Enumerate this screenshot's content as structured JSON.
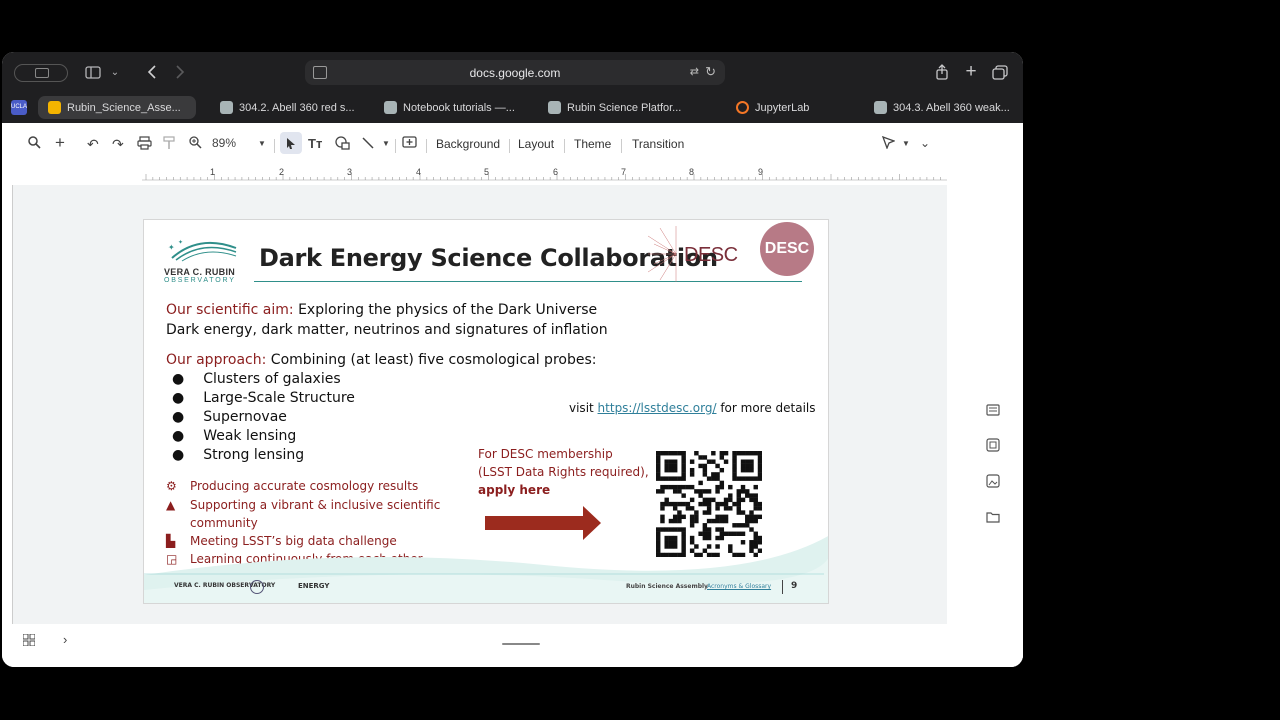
{
  "browser": {
    "url": "docs.google.com",
    "tabs": [
      {
        "label": "Rubin_Science_Asse...",
        "active": true,
        "favicon": "slides-icon",
        "color": "#f4b400"
      },
      {
        "label": "304.2. Abell 360 red s...",
        "active": false,
        "favicon": "notebook-icon",
        "color": "#9aa"
      },
      {
        "label": "Notebook tutorials —...",
        "active": false,
        "favicon": "notebook-icon",
        "color": "#9aa"
      },
      {
        "label": "Rubin Science Platfor...",
        "active": false,
        "favicon": "notebook-icon",
        "color": "#9aa"
      },
      {
        "label": "JupyterLab",
        "active": false,
        "favicon": "jupyter-icon",
        "color": "#f37626"
      },
      {
        "label": "304.3. Abell 360 weak...",
        "active": false,
        "favicon": "notebook-icon",
        "color": "#9aa"
      }
    ]
  },
  "toolbar": {
    "zoom": "89%",
    "menus": [
      "Background",
      "Layout",
      "Theme",
      "Transition"
    ]
  },
  "ruler": {
    "ticks": [
      "1",
      "2",
      "3",
      "4",
      "5",
      "6",
      "7",
      "8",
      "9"
    ]
  },
  "slide": {
    "rubin_logo": {
      "line1": "VERA C. RUBIN",
      "line2": "OBSERVATORY"
    },
    "title": "Dark Energy Science Collaboration",
    "desc_wordmark": "DESC",
    "desc_badge": "DESC",
    "aim_label": "Our scientific aim:",
    "aim_text": " Exploring the physics of the Dark Universe",
    "aim_line2": "Dark energy, dark matter, neutrinos and signatures of inflation",
    "approach_label": "Our approach:",
    "approach_text": " Combining (at least) five cosmological probes:",
    "probes": [
      "Clusters of galaxies",
      "Large-Scale Structure",
      "Supernovae",
      "Weak lensing",
      "Strong lensing"
    ],
    "visit_prefix": "visit ",
    "visit_link": "https://lsstdesc.org/",
    "visit_suffix": " for more details",
    "membership_line1": "For DESC membership",
    "membership_line2": "(LSST Data Rights required),",
    "membership_line3": "apply here",
    "features": [
      {
        "icon": "gears-icon",
        "text": "Producing accurate cosmology results"
      },
      {
        "icon": "graduation-cap-icon",
        "text": "Supporting a vibrant & inclusive scientific"
      },
      {
        "icon": "",
        "text": "community"
      },
      {
        "icon": "factory-icon",
        "text": "Meeting LSST’s big data challenge"
      },
      {
        "icon": "teacher-board-icon",
        "text": "Learning continuously from each other"
      }
    ],
    "footer": {
      "rubin": "VERA C. RUBIN OBSERVATORY",
      "energy": "ENERGY",
      "assembly": "Rubin Science Assembly",
      "glossary": "Acronyms & Glossary",
      "page": "9"
    }
  },
  "colors": {
    "accent_red": "#8b1e1e",
    "teal": "#2f8f8a"
  }
}
